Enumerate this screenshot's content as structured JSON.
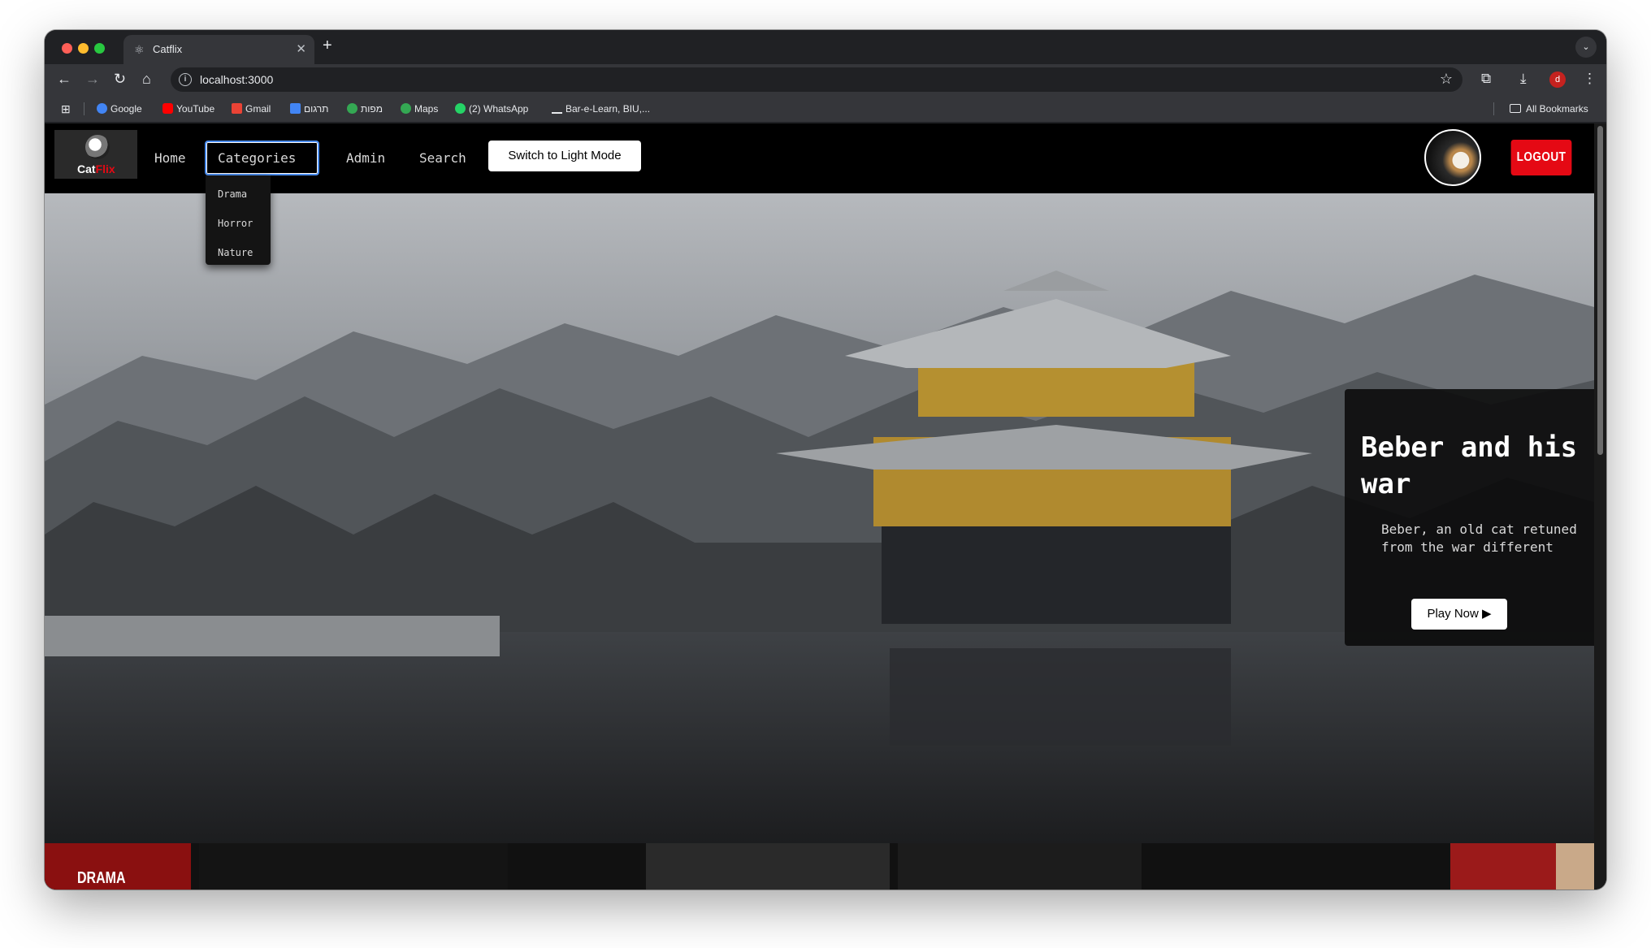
{
  "browser": {
    "tab_title": "Catflix",
    "url": "localhost:3000",
    "profile_initial": "d",
    "bookmarks": [
      {
        "label": "Google",
        "color": "#4285f4"
      },
      {
        "label": "YouTube",
        "color": "#ff0000"
      },
      {
        "label": "Gmail",
        "color": "#ea4335"
      },
      {
        "label": "תרגום",
        "color": "#4285f4"
      },
      {
        "label": "מפות",
        "color": "#34a853"
      },
      {
        "label": "Maps",
        "color": "#34a853"
      },
      {
        "label": "(2) WhatsApp",
        "color": "#25d366"
      },
      {
        "label": "Bar-e-Learn, BIU,...",
        "color": "#e8eaed"
      }
    ],
    "all_bookmarks_label": "All Bookmarks"
  },
  "site": {
    "logo_text_main": "Cat",
    "logo_text_accent": "Flix",
    "accent_color": "#e50914",
    "nav": {
      "home": "Home",
      "categories": "Categories",
      "admin": "Admin",
      "search": "Search",
      "theme_toggle": "Switch to Light Mode",
      "logout": "LOGOUT"
    },
    "categories_menu": [
      "Drama",
      "Horror",
      "Nature"
    ]
  },
  "hero": {
    "title": "Beber and his war",
    "description": "Beber, an old cat retuned from the war different",
    "play_label": "Play Now ▶"
  },
  "sections": {
    "first_row_label": "DRAMA"
  }
}
